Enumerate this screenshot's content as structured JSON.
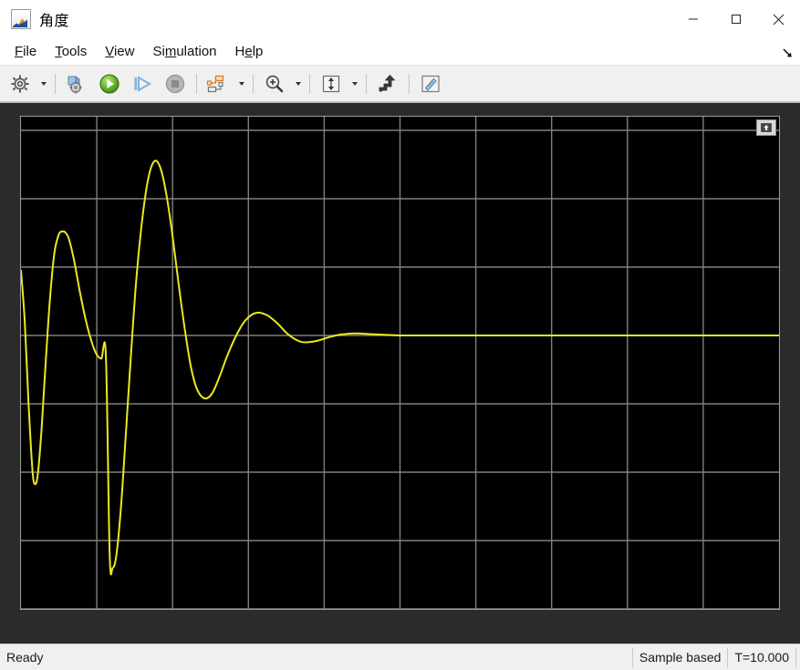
{
  "window": {
    "title": "角度",
    "icon": "matlab-scope-icon",
    "controls": [
      {
        "name": "minimize-button",
        "glyph": "minimize"
      },
      {
        "name": "maximize-button",
        "glyph": "maximize"
      },
      {
        "name": "close-button",
        "glyph": "close"
      }
    ]
  },
  "menubar": {
    "items": [
      {
        "name": "menu-file",
        "mnemonic": "F",
        "rest": "ile"
      },
      {
        "name": "menu-tools",
        "mnemonic": "T",
        "rest": "ools"
      },
      {
        "name": "menu-view",
        "mnemonic": "V",
        "rest": "iew"
      },
      {
        "name": "menu-simulation",
        "pre": "Si",
        "mnemonic": "m",
        "rest": "ulation"
      },
      {
        "name": "menu-help",
        "pre": "H",
        "mnemonic": "e",
        "rest": "lp"
      }
    ],
    "overflow_glyph": "↘"
  },
  "toolbar": {
    "buttons": [
      {
        "name": "configuration-properties-icon",
        "tooltip": "Configuration Properties",
        "dropdown": true
      },
      {
        "name": "run-simulation-with-settings-icon",
        "tooltip": "Simulink Settings",
        "dropdown": false
      },
      {
        "name": "run-icon",
        "tooltip": "Run",
        "dropdown": false
      },
      {
        "name": "step-forward-icon",
        "tooltip": "Step Forward",
        "dropdown": false
      },
      {
        "name": "stop-icon",
        "tooltip": "Stop",
        "dropdown": false
      },
      {
        "name": "signal-selection-icon",
        "tooltip": "Signal Selection",
        "dropdown": true
      },
      {
        "name": "zoom-in-icon",
        "tooltip": "Zoom In",
        "dropdown": true
      },
      {
        "name": "autoscale-icon",
        "tooltip": "Autoscale",
        "dropdown": true
      },
      {
        "name": "cursor-measurements-icon",
        "tooltip": "Cursor Measurements",
        "dropdown": false
      },
      {
        "name": "measurements-ruler-icon",
        "tooltip": "Measurements",
        "dropdown": false
      }
    ]
  },
  "plot": {
    "maximize_axes_label": "⬆",
    "line_color": "#e9e920",
    "background_color": "#000000",
    "grid_color": "#808080",
    "axis_text_color": "#b9b9b9",
    "panel_color": "#2b2b2b"
  },
  "statusbar": {
    "state": "Ready",
    "frame_mode": "Sample based",
    "sim_time": "T=10.000"
  },
  "chart_data": {
    "type": "line",
    "title": "角度",
    "xlabel": "",
    "ylabel": "",
    "xlim": [
      0,
      10
    ],
    "ylim": [
      -4,
      3.2
    ],
    "xticks": [
      0,
      1,
      2,
      3,
      4,
      5,
      6,
      7,
      8,
      9,
      10
    ],
    "yticks": [
      3,
      2,
      1,
      0,
      -1,
      -2,
      -3,
      -4
    ],
    "grid": true,
    "legend": null,
    "series": [
      {
        "name": "角度",
        "color": "#e9e920",
        "x": [
          0,
          0.05,
          0.1,
          0.15,
          0.18,
          0.22,
          0.27,
          0.32,
          0.38,
          0.44,
          0.5,
          0.55,
          0.58,
          0.63,
          0.7,
          0.78,
          0.86,
          0.94,
          1.0,
          1.06,
          1.12,
          1.17,
          1.21,
          1.26,
          1.32,
          1.38,
          1.45,
          1.52,
          1.6,
          1.68,
          1.76,
          1.84,
          1.92,
          2.0,
          2.08,
          2.16,
          2.24,
          2.32,
          2.42,
          2.52,
          2.62,
          2.72,
          2.84,
          2.96,
          3.1,
          3.24,
          3.38,
          3.52,
          3.66,
          3.76,
          3.9,
          4.05,
          4.2,
          4.4,
          4.6,
          4.8,
          5.0,
          5.4,
          6.0,
          7.0,
          8.0,
          9.0,
          10.0
        ],
        "y": [
          0.95,
          0.2,
          -1.0,
          -1.95,
          -2.17,
          -2.05,
          -1.4,
          -0.5,
          0.5,
          1.2,
          1.48,
          1.52,
          1.51,
          1.42,
          1.1,
          0.62,
          0.2,
          -0.12,
          -0.28,
          -0.34,
          -0.3,
          -3.2,
          -3.4,
          -3.2,
          -2.5,
          -1.5,
          -0.3,
          0.8,
          1.7,
          2.3,
          2.55,
          2.45,
          2.05,
          1.45,
          0.75,
          0.1,
          -0.45,
          -0.78,
          -0.92,
          -0.85,
          -0.6,
          -0.3,
          0.0,
          0.22,
          0.33,
          0.3,
          0.18,
          0.02,
          -0.08,
          -0.1,
          -0.08,
          -0.03,
          0.01,
          0.03,
          0.02,
          0.01,
          0.0,
          0.0,
          0.0,
          0.0,
          0.0,
          0.0,
          0.0
        ]
      }
    ],
    "description": "Damped oscillating angle response settling to 0 after about 5 seconds"
  }
}
